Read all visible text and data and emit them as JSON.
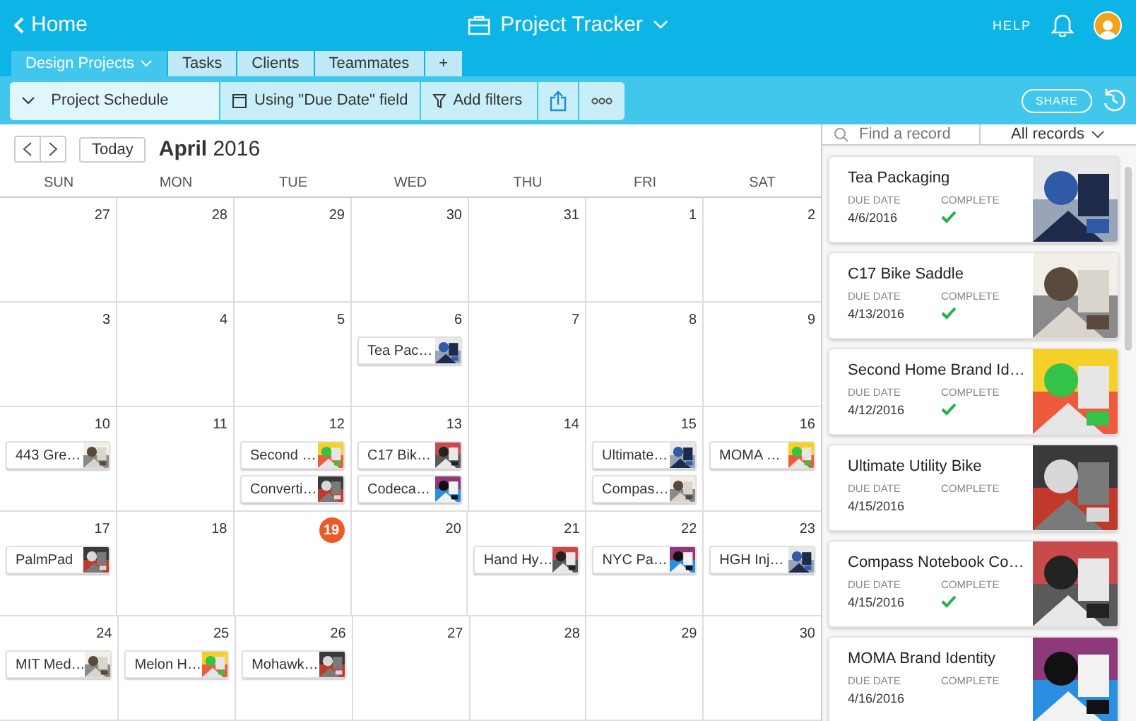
{
  "header": {
    "back": "Home",
    "title": "Project Tracker",
    "help": "HELP"
  },
  "tabs": [
    {
      "label": "Design Projects",
      "selected": true
    },
    {
      "label": "Tasks",
      "selected": false
    },
    {
      "label": "Clients",
      "selected": false
    },
    {
      "label": "Teammates",
      "selected": false
    }
  ],
  "add_tab": "+",
  "toolbar": {
    "view": "Project Schedule",
    "date_field": "Using \"Due Date\" field",
    "filters": "Add filters",
    "share": "SHARE"
  },
  "calendar": {
    "month": "April",
    "year": "2016",
    "today_button": "Today",
    "weekdays": [
      "SUN",
      "MON",
      "TUE",
      "WED",
      "THU",
      "FRI",
      "SAT"
    ],
    "weeks": [
      [
        {
          "date": "27",
          "today": false
        },
        {
          "date": "28",
          "today": false
        },
        {
          "date": "29",
          "today": false
        },
        {
          "date": "30",
          "today": false
        },
        {
          "date": "31",
          "today": false
        },
        {
          "date": "1",
          "today": false
        },
        {
          "date": "2",
          "today": false
        }
      ],
      [
        {
          "date": "3",
          "today": false
        },
        {
          "date": "4",
          "today": false
        },
        {
          "date": "5",
          "today": false
        },
        {
          "date": "6",
          "today": false,
          "events": [
            "Tea Pac…"
          ]
        },
        {
          "date": "7",
          "today": false
        },
        {
          "date": "8",
          "today": false
        },
        {
          "date": "9",
          "today": false
        }
      ],
      [
        {
          "date": "10",
          "today": false,
          "events": [
            "443 Gre…"
          ]
        },
        {
          "date": "11",
          "today": false
        },
        {
          "date": "12",
          "today": false,
          "events": [
            "Second …",
            "Converti…"
          ]
        },
        {
          "date": "13",
          "today": false,
          "events": [
            "C17 Bik…",
            "Codeca…"
          ]
        },
        {
          "date": "14",
          "today": false
        },
        {
          "date": "15",
          "today": false,
          "events": [
            "Ultimate…",
            "Compas…"
          ]
        },
        {
          "date": "16",
          "today": false,
          "events": [
            "MOMA …"
          ]
        }
      ],
      [
        {
          "date": "17",
          "today": false,
          "events": [
            "PalmPad"
          ]
        },
        {
          "date": "18",
          "today": false
        },
        {
          "date": "19",
          "today": true
        },
        {
          "date": "20",
          "today": false
        },
        {
          "date": "21",
          "today": false,
          "events": [
            "Hand Hy…"
          ]
        },
        {
          "date": "22",
          "today": false,
          "events": [
            "NYC Pa…"
          ]
        },
        {
          "date": "23",
          "today": false,
          "events": [
            "HGH Inj…"
          ]
        }
      ],
      [
        {
          "date": "24",
          "today": false,
          "events": [
            "MIT Med…"
          ]
        },
        {
          "date": "25",
          "today": false,
          "events": [
            "Melon H…"
          ]
        },
        {
          "date": "26",
          "today": false,
          "events": [
            "Mohawk…"
          ]
        },
        {
          "date": "27",
          "today": false
        },
        {
          "date": "28",
          "today": false
        },
        {
          "date": "29",
          "today": false
        },
        {
          "date": "30",
          "today": false
        }
      ]
    ]
  },
  "records_panel": {
    "search": {
      "placeholder": "Find a record"
    },
    "filter": "All records",
    "records": [
      {
        "title": "Tea Packaging",
        "due_label": "DUE DATE",
        "due_date": "4/6/2016",
        "complete_label": "COMPLETE",
        "complete": true
      },
      {
        "title": "C17 Bike Saddle",
        "due_label": "DUE DATE",
        "due_date": "4/13/2016",
        "complete_label": "COMPLETE",
        "complete": true
      },
      {
        "title": "Second Home Brand Id…",
        "due_label": "DUE DATE",
        "due_date": "4/12/2016",
        "complete_label": "COMPLETE",
        "complete": true
      },
      {
        "title": "Ultimate Utility Bike",
        "due_label": "DUE DATE",
        "due_date": "4/15/2016",
        "complete_label": "COMPLETE",
        "complete": false
      },
      {
        "title": "Compass Notebook Co…",
        "due_label": "DUE DATE",
        "due_date": "4/15/2016",
        "complete_label": "COMPLETE",
        "complete": true
      },
      {
        "title": "MOMA Brand Identity",
        "due_label": "DUE DATE",
        "due_date": "4/16/2016",
        "complete_label": "COMPLETE",
        "complete": false
      }
    ]
  }
}
